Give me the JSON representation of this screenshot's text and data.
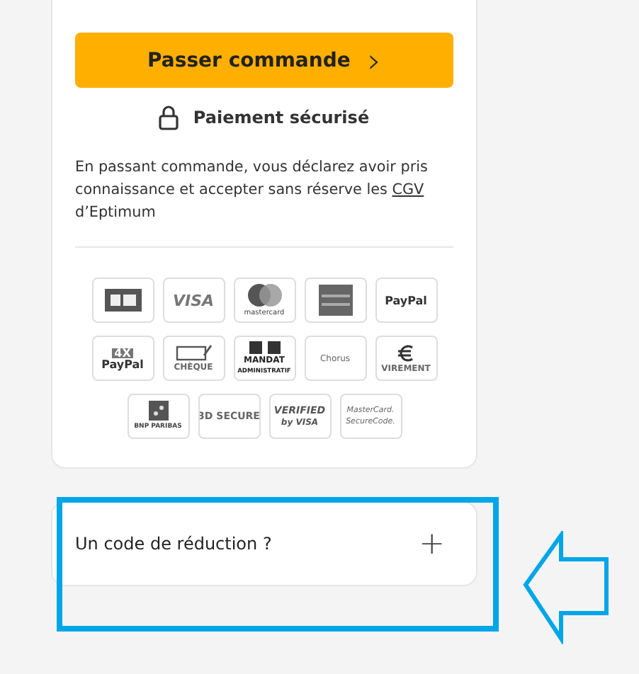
{
  "order_button": {
    "label": "Passer commande",
    "chevron": "›"
  },
  "secure": {
    "label": "Paiement sécurisé"
  },
  "terms": {
    "text": "En passant commande, vous déclarez avoir pris connaissance et accepter sans réserve les",
    "link": "CGV",
    "after": "d’Eptimum"
  },
  "payment_methods": [
    [
      {
        "kind": "cb"
      },
      {
        "kind": "visa",
        "lines": [
          "VISA"
        ]
      },
      {
        "kind": "mastercard",
        "lines": [
          "mastercard"
        ]
      },
      {
        "kind": "amex"
      },
      {
        "kind": "paypal",
        "lines": [
          "PayPal"
        ]
      }
    ],
    [
      {
        "kind": "paypal4x",
        "lines": [
          "4X",
          "PayPal"
        ]
      },
      {
        "kind": "cheque",
        "lines": [
          "CHÈQUE"
        ]
      },
      {
        "kind": "mandat",
        "lines": [
          "MANDAT",
          "ADMINISTRATIF"
        ]
      },
      {
        "kind": "chorus",
        "lines": [
          "Chorus"
        ]
      },
      {
        "kind": "virement",
        "lines": [
          "VIREMENT"
        ]
      }
    ],
    [
      {
        "kind": "bnp",
        "lines": [
          "BNP PARIBAS"
        ]
      },
      {
        "kind": "word",
        "lines": [
          "3D SECURE"
        ]
      },
      {
        "kind": "vbv",
        "lines": [
          "VERIFIED",
          "by VISA"
        ]
      },
      {
        "kind": "mcsecure",
        "lines": [
          "MasterCard.",
          "SecureCode."
        ]
      }
    ]
  ],
  "discount": {
    "label": "Un code de réduction ?",
    "toggle": "+",
    "expanded": false
  }
}
